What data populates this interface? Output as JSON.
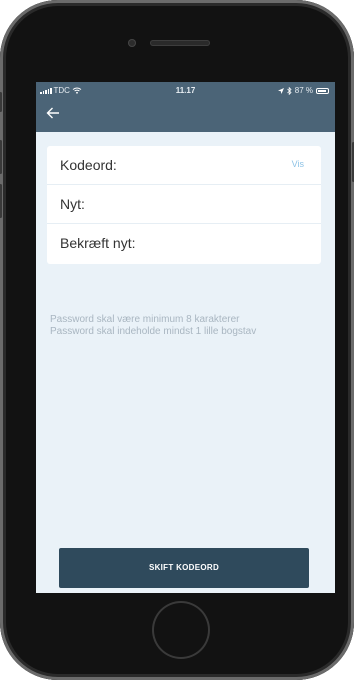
{
  "status_bar": {
    "carrier": "TDC",
    "time": "11.17",
    "battery": "87 %"
  },
  "nav": {
    "back_icon": "arrow-left-icon"
  },
  "form": {
    "current_label": "Kodeord:",
    "show_label": "Vis",
    "new_label": "Nyt:",
    "confirm_label": "Bekræft nyt:"
  },
  "hints": {
    "line1": "Password skal være minimum 8 karakterer",
    "line2": "Password skal indeholde mindst 1 lille bogstav"
  },
  "submit_label": "SKIFT KODEORD",
  "colors": {
    "topbar": "#4b6477",
    "screen_bg": "#eaf2f8",
    "button": "#2f4a5c",
    "link": "#8ec3e6"
  }
}
